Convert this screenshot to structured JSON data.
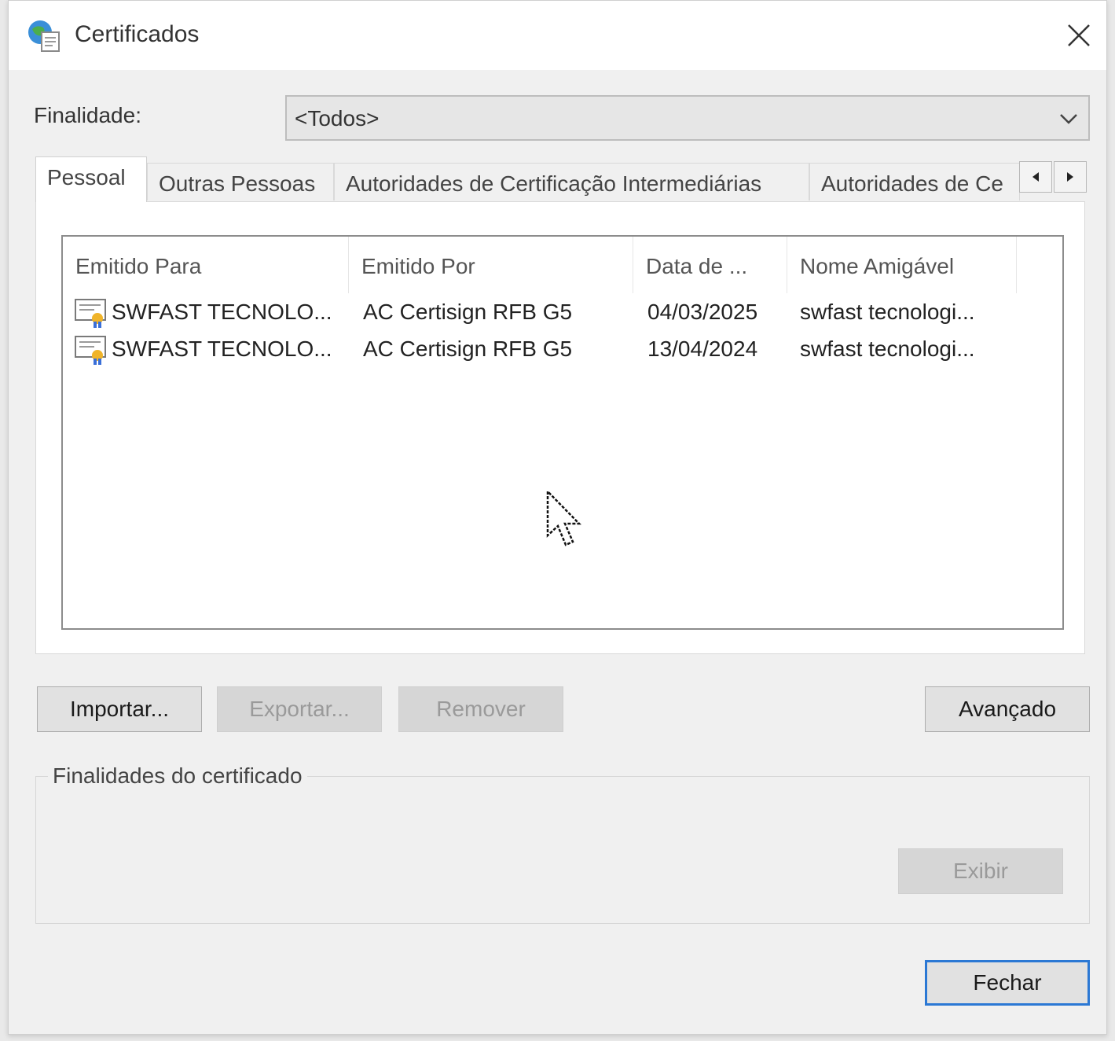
{
  "window": {
    "title": "Certificados",
    "icon": "certificate-globe-icon",
    "close_icon": "close-icon"
  },
  "purpose": {
    "label": "Finalidade:",
    "selected": "<Todos>"
  },
  "tabs": [
    {
      "label": "Pessoal",
      "active": true
    },
    {
      "label": "Outras Pessoas",
      "active": false
    },
    {
      "label": "Autoridades de Certificação Intermediárias",
      "active": false
    },
    {
      "label": "Autoridades de Ce",
      "active": false
    }
  ],
  "list": {
    "columns": [
      "Emitido Para",
      "Emitido Por",
      "Data de ...",
      "Nome Amigável"
    ],
    "rows": [
      {
        "issued_to": "SWFAST TECNOLO...",
        "issued_by": "AC Certisign RFB G5",
        "date": "04/03/2025",
        "friendly": "swfast tecnologi..."
      },
      {
        "issued_to": "SWFAST TECNOLO...",
        "issued_by": "AC Certisign RFB G5",
        "date": "13/04/2024",
        "friendly": "swfast tecnologi..."
      }
    ]
  },
  "buttons": {
    "import": "Importar...",
    "export": "Exportar...",
    "remove": "Remover",
    "advanced": "Avançado",
    "view": "Exibir",
    "close": "Fechar"
  },
  "purposes_group": {
    "label": "Finalidades do certificado"
  },
  "colors": {
    "accent": "#2b78d4",
    "window_bg": "#f0f0f0"
  }
}
